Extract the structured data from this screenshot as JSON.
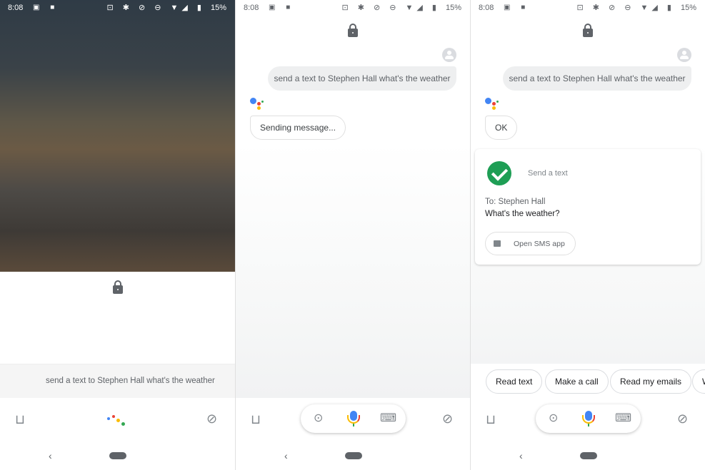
{
  "status": {
    "time": "8:08",
    "battery": "15%"
  },
  "query": "send a text to Stephen Hall what's the weather",
  "panel2": {
    "assistant_reply": "Sending message..."
  },
  "panel3": {
    "assistant_reply": "OK",
    "card": {
      "title": "Send a text",
      "to": "To: Stephen Hall",
      "message": "What's the weather?",
      "button": "Open SMS app"
    },
    "chips": [
      "Read text",
      "Make a call",
      "Read my emails",
      "W"
    ]
  },
  "colors": {
    "check": "#1e9e55",
    "google_blue": "#4285f4",
    "google_red": "#ea4335",
    "google_yellow": "#fbbc04",
    "google_green": "#34a853"
  }
}
